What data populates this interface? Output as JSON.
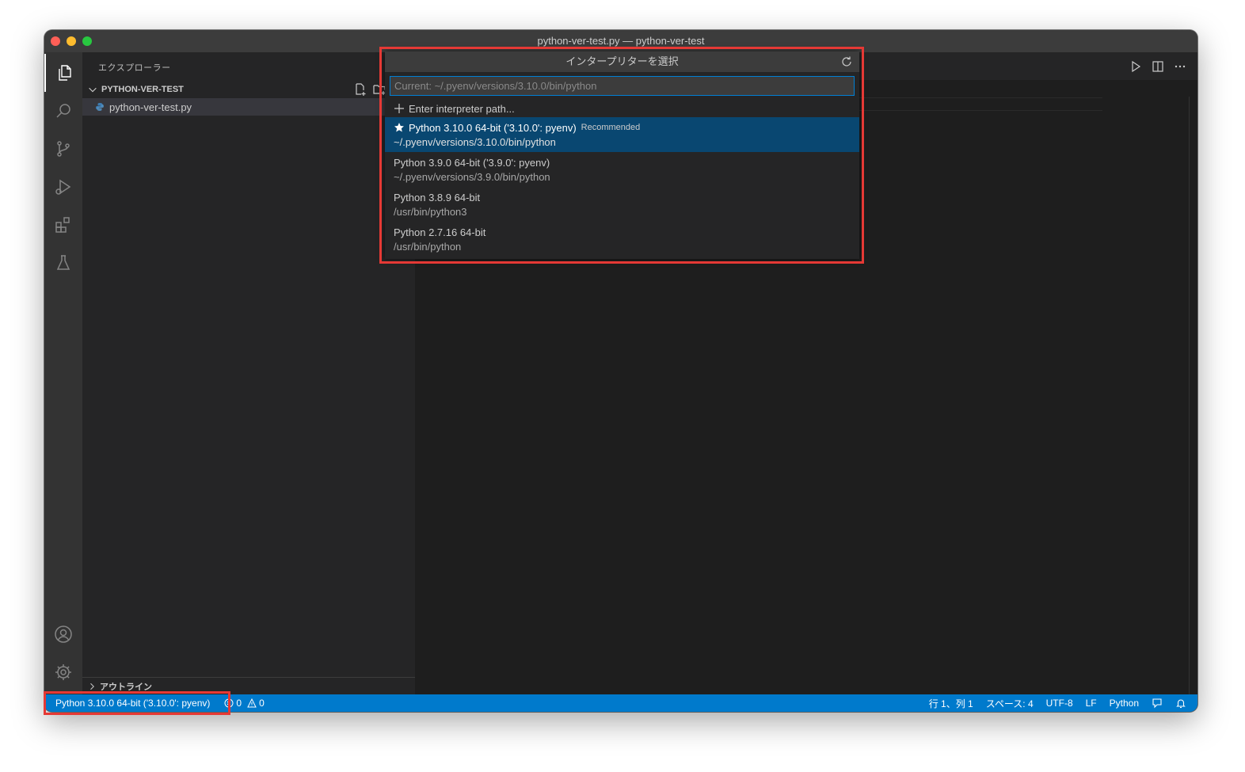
{
  "window": {
    "title": "python-ver-test.py — python-ver-test"
  },
  "sidebar": {
    "title": "エクスプローラー",
    "folder_name": "PYTHON-VER-TEST",
    "files": [
      "python-ver-test.py"
    ],
    "outline_label": "アウトライン"
  },
  "quickpick": {
    "title": "インタープリターを選択",
    "input_placeholder": "Current: ~/.pyenv/versions/3.10.0/bin/python",
    "enter_path_label": "Enter interpreter path...",
    "items": [
      {
        "label": "Python 3.10.0 64-bit ('3.10.0': pyenv)",
        "badge": "Recommended",
        "path": "~/.pyenv/versions/3.10.0/bin/python",
        "selected": true
      },
      {
        "label": "Python 3.9.0 64-bit ('3.9.0': pyenv)",
        "badge": "",
        "path": "~/.pyenv/versions/3.9.0/bin/python",
        "selected": false
      },
      {
        "label": "Python 3.8.9 64-bit",
        "badge": "",
        "path": "/usr/bin/python3",
        "selected": false
      },
      {
        "label": "Python 2.7.16 64-bit",
        "badge": "",
        "path": "/usr/bin/python",
        "selected": false
      }
    ]
  },
  "statusbar": {
    "interpreter": "Python 3.10.0 64-bit ('3.10.0': pyenv)",
    "errors": "0",
    "warnings": "0",
    "cursor_position": "行 1、列 1",
    "indent": "スペース: 4",
    "encoding": "UTF-8",
    "eol": "LF",
    "language": "Python"
  },
  "colors": {
    "statusbar_bg": "#007acc",
    "selection_bg": "#094771",
    "highlight_red": "#e53935"
  },
  "icons": {
    "activitybar": [
      "files-icon",
      "search-icon",
      "source-control-icon",
      "run-debug-icon",
      "extensions-icon",
      "testing-icon",
      "account-icon",
      "settings-gear-icon"
    ],
    "editor_actions": [
      "run-icon",
      "split-editor-icon",
      "more-actions-icon"
    ]
  }
}
